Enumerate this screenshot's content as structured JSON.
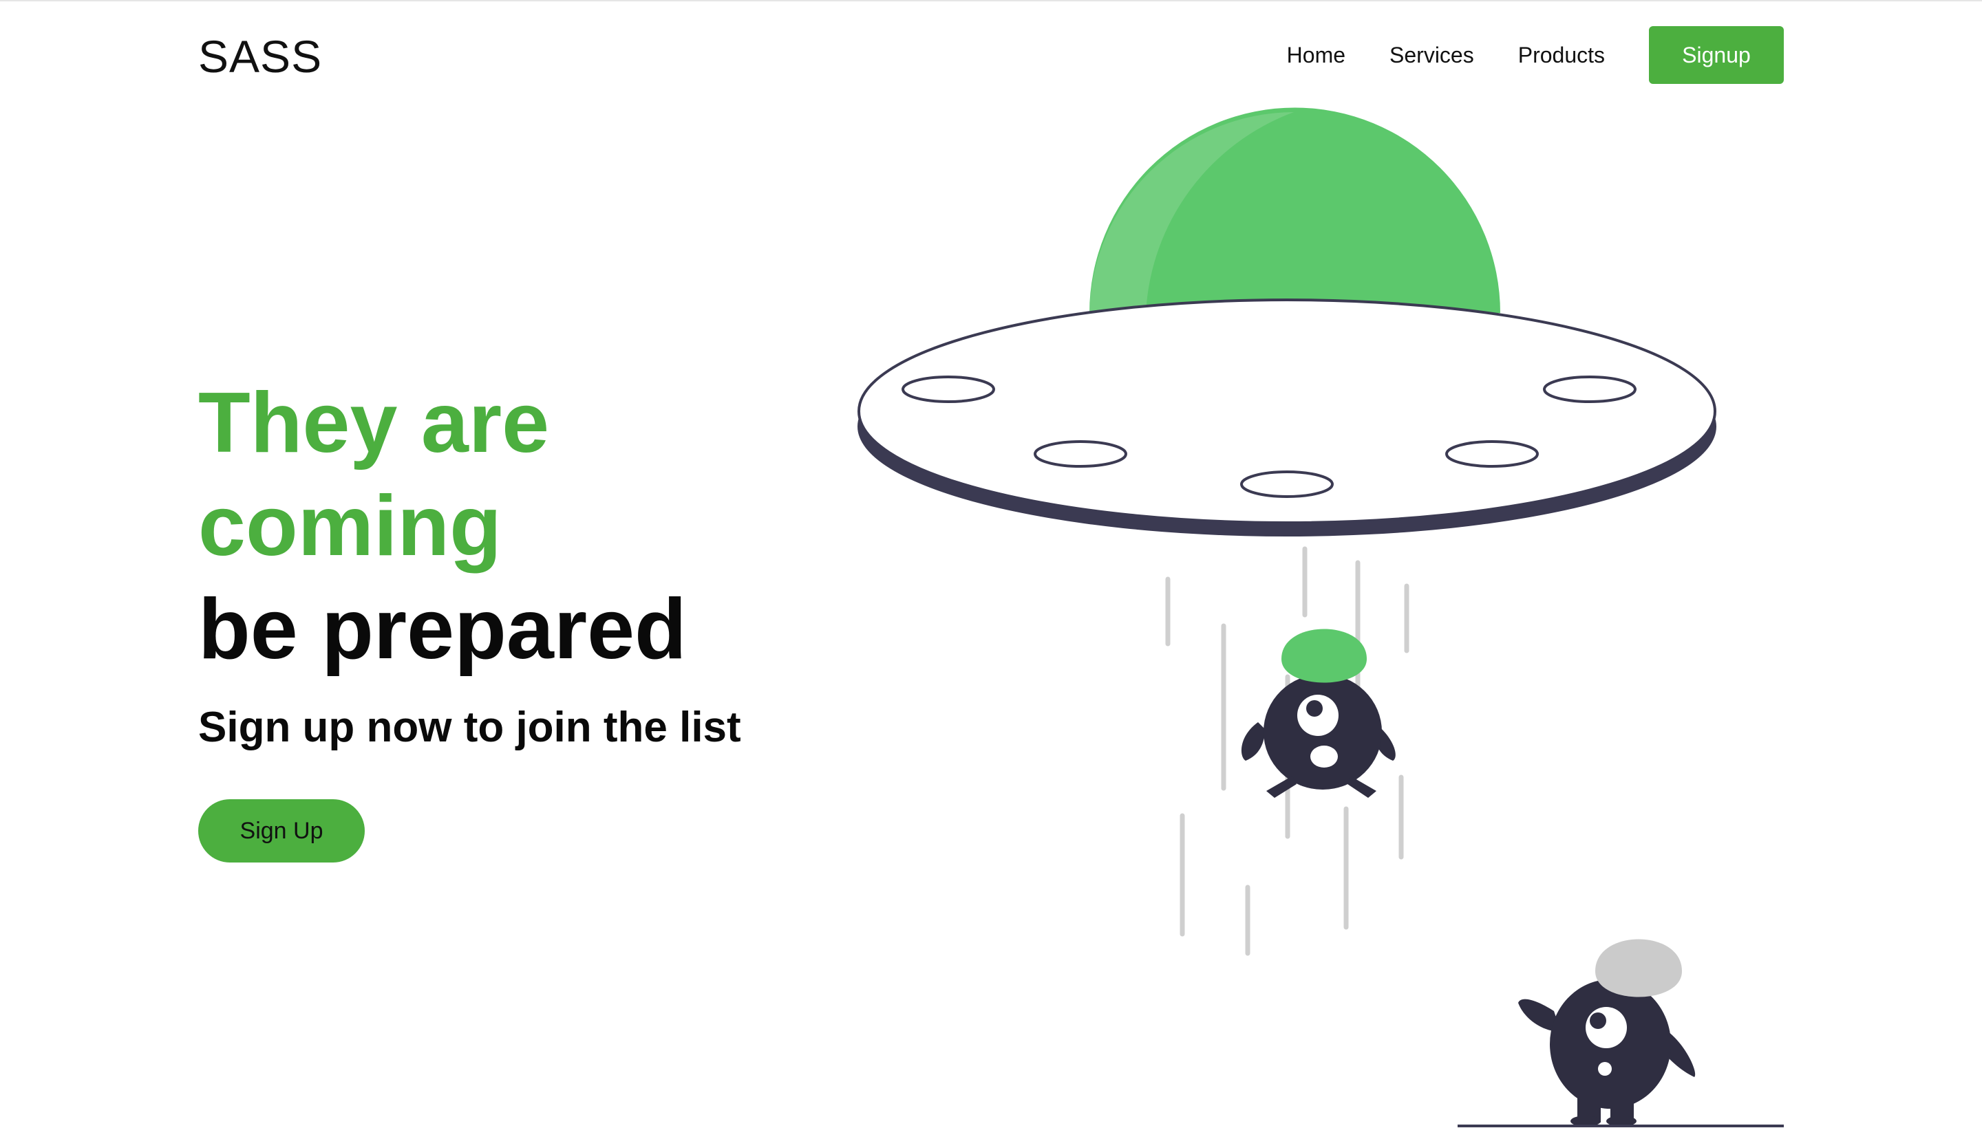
{
  "header": {
    "logo": "SASS",
    "nav": [
      {
        "label": "Home"
      },
      {
        "label": "Services"
      },
      {
        "label": "Products"
      }
    ],
    "signup_label": "Signup"
  },
  "hero": {
    "headline_green_1": "They are",
    "headline_green_2": "coming",
    "headline_dark": "be prepared",
    "subheadline": "Sign up now to join the list",
    "cta_label": "Sign Up"
  },
  "colors": {
    "accent": "#4caf3f",
    "ufo_dome": "#5cc86c",
    "ufo_dark": "#3b3a52",
    "alien_body": "#2f2e41",
    "beam": "#cfcfcf",
    "helmet_grey": "#cbcbcb"
  },
  "illustration": {
    "icon": "ufo-abduction-illustration"
  }
}
